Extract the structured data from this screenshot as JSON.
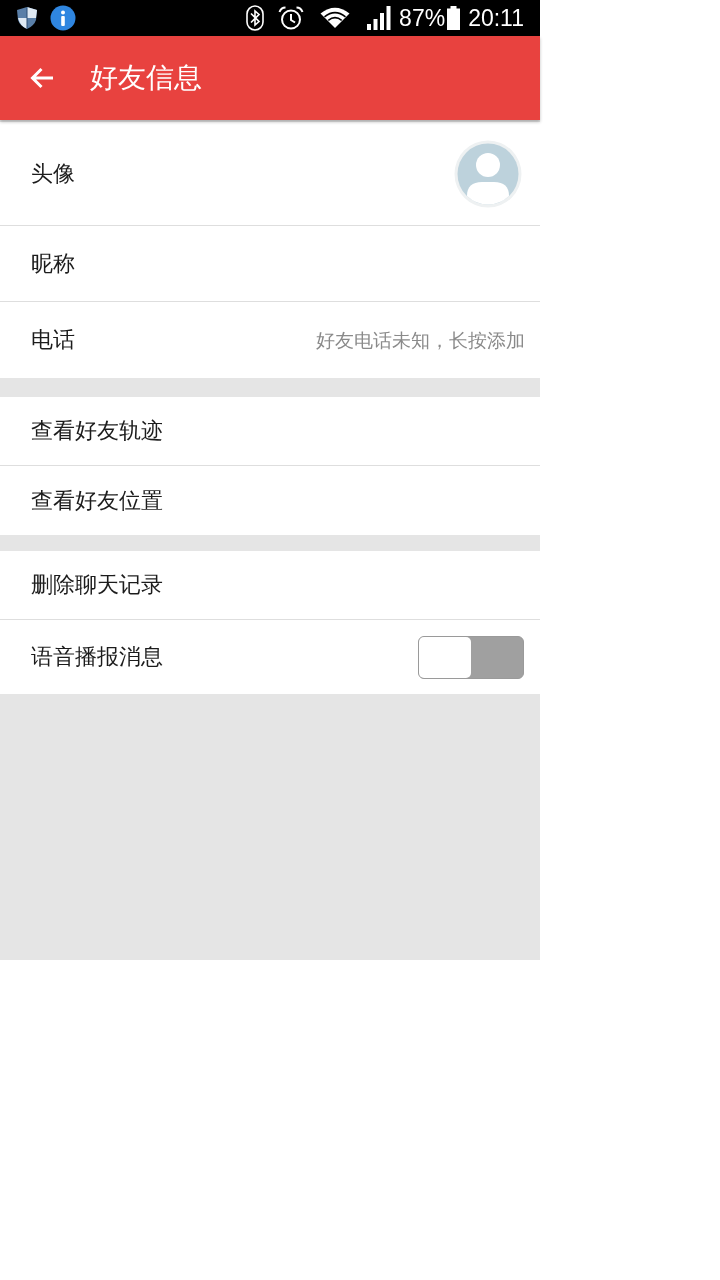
{
  "status_bar": {
    "battery": "87%",
    "time": "20:11"
  },
  "app_bar": {
    "title": "好友信息"
  },
  "sections": [
    {
      "rows": [
        {
          "kind": "avatar",
          "label": "头像"
        },
        {
          "kind": "plain",
          "label": "昵称"
        },
        {
          "kind": "value",
          "label": "电话",
          "value": "好友电话未知，长按添加"
        }
      ]
    },
    {
      "rows": [
        {
          "kind": "plain",
          "label": "查看好友轨迹"
        },
        {
          "kind": "plain",
          "label": "查看好友位置"
        }
      ]
    },
    {
      "rows": [
        {
          "kind": "plain",
          "label": "删除聊天记录"
        },
        {
          "kind": "toggle",
          "label": "语音播报消息",
          "on": false
        }
      ]
    }
  ]
}
